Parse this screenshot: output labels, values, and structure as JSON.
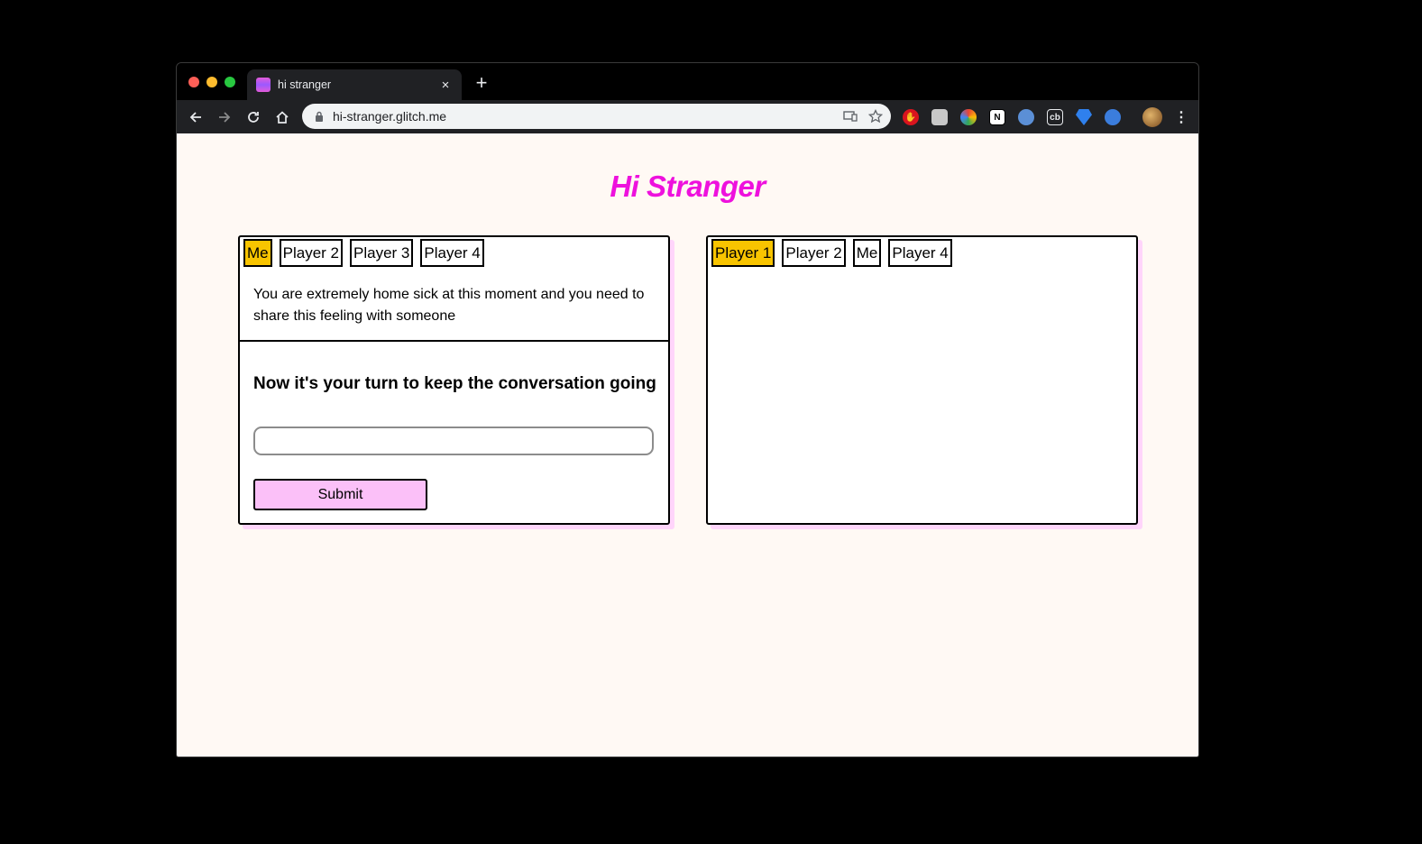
{
  "browser": {
    "tab_title": "hi stranger",
    "url": "hi-stranger.glitch.me",
    "new_tab": "+",
    "close": "×"
  },
  "page": {
    "title": "Hi Stranger",
    "left_card": {
      "tabs": [
        {
          "label": "Me",
          "active": true
        },
        {
          "label": "Player 2",
          "active": false
        },
        {
          "label": "Player 3",
          "active": false
        },
        {
          "label": "Player 4",
          "active": false
        }
      ],
      "prompt": "You are extremely home sick at this moment and you need to share this feeling with someone",
      "turn_heading": "Now it's your turn to keep the conversation going",
      "input_value": "",
      "submit_label": "Submit"
    },
    "right_card": {
      "tabs": [
        {
          "label": "Player 1",
          "active": true
        },
        {
          "label": "Player 2",
          "active": false
        },
        {
          "label": "Me",
          "active": false
        },
        {
          "label": "Player 4",
          "active": false
        }
      ]
    }
  },
  "colors": {
    "title": "#ee11dd",
    "active_tab": "#f8c400",
    "submit": "#fbc0f8",
    "page_bg": "#fff9f4"
  }
}
